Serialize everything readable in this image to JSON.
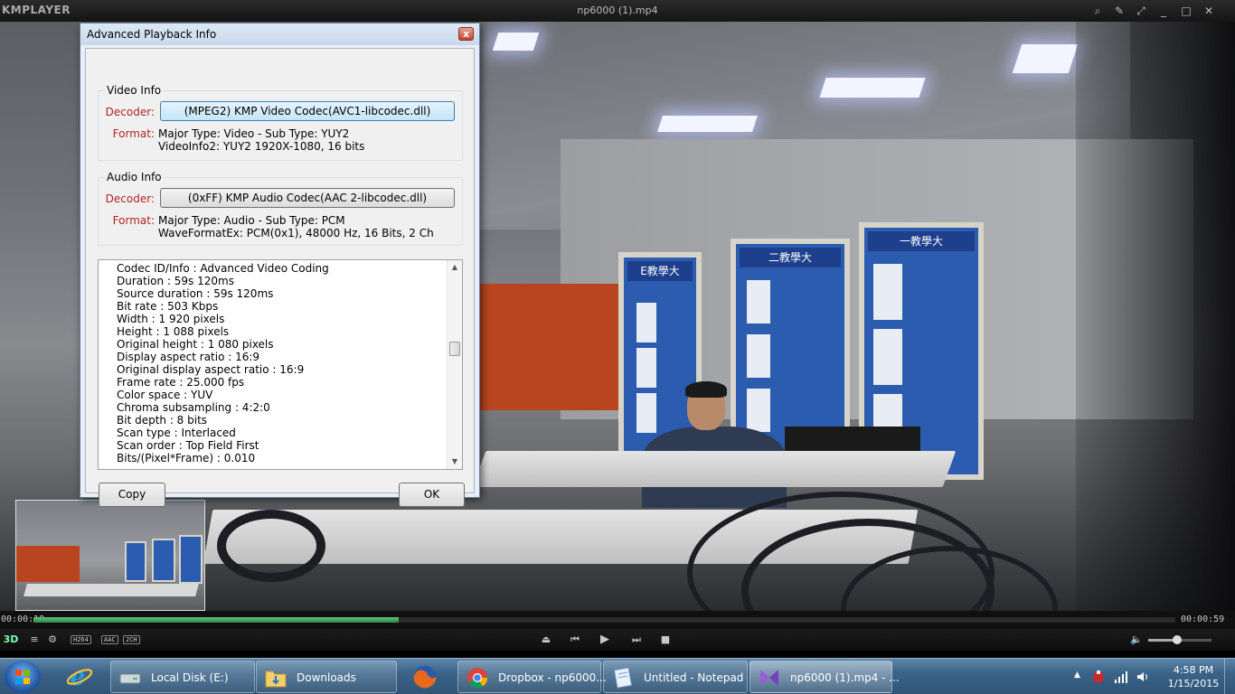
{
  "player": {
    "logo": "KMPLAYER",
    "window_title": "np6000 (1).mp4",
    "controls": {
      "search": "⌕",
      "pin": "✎",
      "fullscreen": "⤢",
      "minimize": "_",
      "maximize": "□",
      "close": "✕"
    },
    "elapsed": "00:00:18",
    "total": "00:00:59",
    "progress_fraction": 0.32,
    "volume_fraction": 0.45,
    "codec_tags": [
      "H264",
      "AAC",
      "2CH"
    ],
    "label_3d": "3D"
  },
  "dialog": {
    "title": "Advanced Playback Info",
    "close_label": "x",
    "video": {
      "group_label": "Video Info",
      "decoder_label": "Decoder:",
      "decoder_value": "(MPEG2) KMP Video Codec(AVC1-libcodec.dll)",
      "format_label": "Format:",
      "format_line1": "Major Type: Video - Sub Type: YUY2",
      "format_line2": "VideoInfo2: YUY2 1920X-1080, 16 bits"
    },
    "audio": {
      "group_label": "Audio Info",
      "decoder_label": "Decoder:",
      "decoder_value": "(0xFF) KMP Audio Codec(AAC 2-libcodec.dll)",
      "format_label": "Format:",
      "format_line1": "Major Type: Audio - Sub Type: PCM",
      "format_line2": "WaveFormatEx: PCM(0x1), 48000 Hz, 16 Bits, 2 Ch"
    },
    "details": [
      "Codec ID/Info : Advanced Video Coding",
      "Duration : 59s 120ms",
      "Source duration : 59s 120ms",
      "Bit rate : 503 Kbps",
      "Width : 1 920 pixels",
      "Height : 1 088 pixels",
      "Original height : 1 080 pixels",
      "Display aspect ratio : 16:9",
      "Original display aspect ratio : 16:9",
      "Frame rate : 25.000 fps",
      "Color space : YUV",
      "Chroma subsampling : 4:2:0",
      "Bit depth : 8 bits",
      "Scan type : Interlaced",
      "Scan order : Top Field First",
      "Bits/(Pixel*Frame) : 0.010"
    ],
    "copy_label": "Copy",
    "ok_label": "OK"
  },
  "scene": {
    "panel_titles": [
      "E教學大",
      "二教學大",
      "一教學大"
    ]
  },
  "taskbar": {
    "items": [
      {
        "label": "Local Disk (E:)"
      },
      {
        "label": "Downloads"
      },
      {
        "label": "Dropbox - np6000..."
      },
      {
        "label": "Untitled - Notepad"
      },
      {
        "label": "np6000 (1).mp4 - ..."
      }
    ],
    "time": "4:58 PM",
    "date": "1/15/2015"
  },
  "colors": {
    "accent_progress": "#2f8a4a",
    "label_red": "#b22222",
    "taskbar": "#3c6488"
  }
}
